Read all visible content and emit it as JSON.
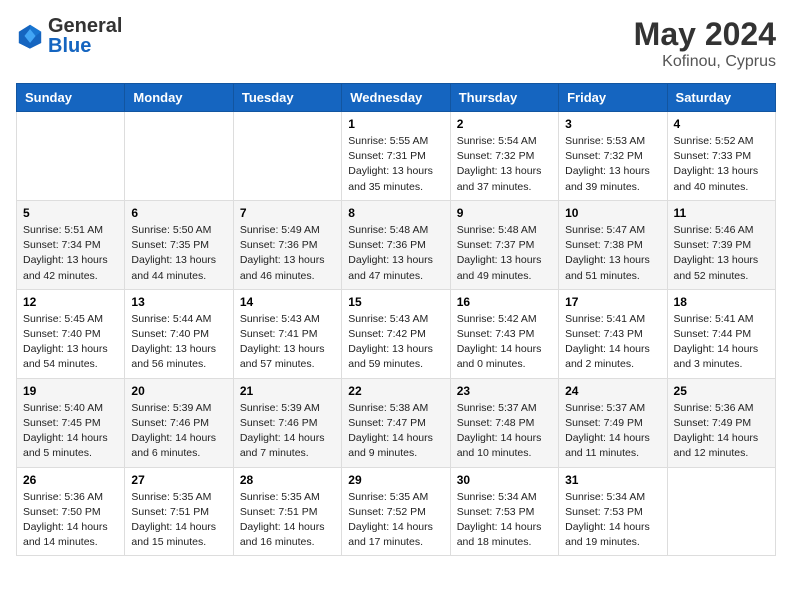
{
  "header": {
    "logo_general": "General",
    "logo_blue": "Blue",
    "month_year": "May 2024",
    "location": "Kofinou, Cyprus"
  },
  "days_of_week": [
    "Sunday",
    "Monday",
    "Tuesday",
    "Wednesday",
    "Thursday",
    "Friday",
    "Saturday"
  ],
  "weeks": [
    [
      {
        "day": "",
        "info": ""
      },
      {
        "day": "",
        "info": ""
      },
      {
        "day": "",
        "info": ""
      },
      {
        "day": "1",
        "info": "Sunrise: 5:55 AM\nSunset: 7:31 PM\nDaylight: 13 hours\nand 35 minutes."
      },
      {
        "day": "2",
        "info": "Sunrise: 5:54 AM\nSunset: 7:32 PM\nDaylight: 13 hours\nand 37 minutes."
      },
      {
        "day": "3",
        "info": "Sunrise: 5:53 AM\nSunset: 7:32 PM\nDaylight: 13 hours\nand 39 minutes."
      },
      {
        "day": "4",
        "info": "Sunrise: 5:52 AM\nSunset: 7:33 PM\nDaylight: 13 hours\nand 40 minutes."
      }
    ],
    [
      {
        "day": "5",
        "info": "Sunrise: 5:51 AM\nSunset: 7:34 PM\nDaylight: 13 hours\nand 42 minutes."
      },
      {
        "day": "6",
        "info": "Sunrise: 5:50 AM\nSunset: 7:35 PM\nDaylight: 13 hours\nand 44 minutes."
      },
      {
        "day": "7",
        "info": "Sunrise: 5:49 AM\nSunset: 7:36 PM\nDaylight: 13 hours\nand 46 minutes."
      },
      {
        "day": "8",
        "info": "Sunrise: 5:48 AM\nSunset: 7:36 PM\nDaylight: 13 hours\nand 47 minutes."
      },
      {
        "day": "9",
        "info": "Sunrise: 5:48 AM\nSunset: 7:37 PM\nDaylight: 13 hours\nand 49 minutes."
      },
      {
        "day": "10",
        "info": "Sunrise: 5:47 AM\nSunset: 7:38 PM\nDaylight: 13 hours\nand 51 minutes."
      },
      {
        "day": "11",
        "info": "Sunrise: 5:46 AM\nSunset: 7:39 PM\nDaylight: 13 hours\nand 52 minutes."
      }
    ],
    [
      {
        "day": "12",
        "info": "Sunrise: 5:45 AM\nSunset: 7:40 PM\nDaylight: 13 hours\nand 54 minutes."
      },
      {
        "day": "13",
        "info": "Sunrise: 5:44 AM\nSunset: 7:40 PM\nDaylight: 13 hours\nand 56 minutes."
      },
      {
        "day": "14",
        "info": "Sunrise: 5:43 AM\nSunset: 7:41 PM\nDaylight: 13 hours\nand 57 minutes."
      },
      {
        "day": "15",
        "info": "Sunrise: 5:43 AM\nSunset: 7:42 PM\nDaylight: 13 hours\nand 59 minutes."
      },
      {
        "day": "16",
        "info": "Sunrise: 5:42 AM\nSunset: 7:43 PM\nDaylight: 14 hours\nand 0 minutes."
      },
      {
        "day": "17",
        "info": "Sunrise: 5:41 AM\nSunset: 7:43 PM\nDaylight: 14 hours\nand 2 minutes."
      },
      {
        "day": "18",
        "info": "Sunrise: 5:41 AM\nSunset: 7:44 PM\nDaylight: 14 hours\nand 3 minutes."
      }
    ],
    [
      {
        "day": "19",
        "info": "Sunrise: 5:40 AM\nSunset: 7:45 PM\nDaylight: 14 hours\nand 5 minutes."
      },
      {
        "day": "20",
        "info": "Sunrise: 5:39 AM\nSunset: 7:46 PM\nDaylight: 14 hours\nand 6 minutes."
      },
      {
        "day": "21",
        "info": "Sunrise: 5:39 AM\nSunset: 7:46 PM\nDaylight: 14 hours\nand 7 minutes."
      },
      {
        "day": "22",
        "info": "Sunrise: 5:38 AM\nSunset: 7:47 PM\nDaylight: 14 hours\nand 9 minutes."
      },
      {
        "day": "23",
        "info": "Sunrise: 5:37 AM\nSunset: 7:48 PM\nDaylight: 14 hours\nand 10 minutes."
      },
      {
        "day": "24",
        "info": "Sunrise: 5:37 AM\nSunset: 7:49 PM\nDaylight: 14 hours\nand 11 minutes."
      },
      {
        "day": "25",
        "info": "Sunrise: 5:36 AM\nSunset: 7:49 PM\nDaylight: 14 hours\nand 12 minutes."
      }
    ],
    [
      {
        "day": "26",
        "info": "Sunrise: 5:36 AM\nSunset: 7:50 PM\nDaylight: 14 hours\nand 14 minutes."
      },
      {
        "day": "27",
        "info": "Sunrise: 5:35 AM\nSunset: 7:51 PM\nDaylight: 14 hours\nand 15 minutes."
      },
      {
        "day": "28",
        "info": "Sunrise: 5:35 AM\nSunset: 7:51 PM\nDaylight: 14 hours\nand 16 minutes."
      },
      {
        "day": "29",
        "info": "Sunrise: 5:35 AM\nSunset: 7:52 PM\nDaylight: 14 hours\nand 17 minutes."
      },
      {
        "day": "30",
        "info": "Sunrise: 5:34 AM\nSunset: 7:53 PM\nDaylight: 14 hours\nand 18 minutes."
      },
      {
        "day": "31",
        "info": "Sunrise: 5:34 AM\nSunset: 7:53 PM\nDaylight: 14 hours\nand 19 minutes."
      },
      {
        "day": "",
        "info": ""
      }
    ]
  ]
}
